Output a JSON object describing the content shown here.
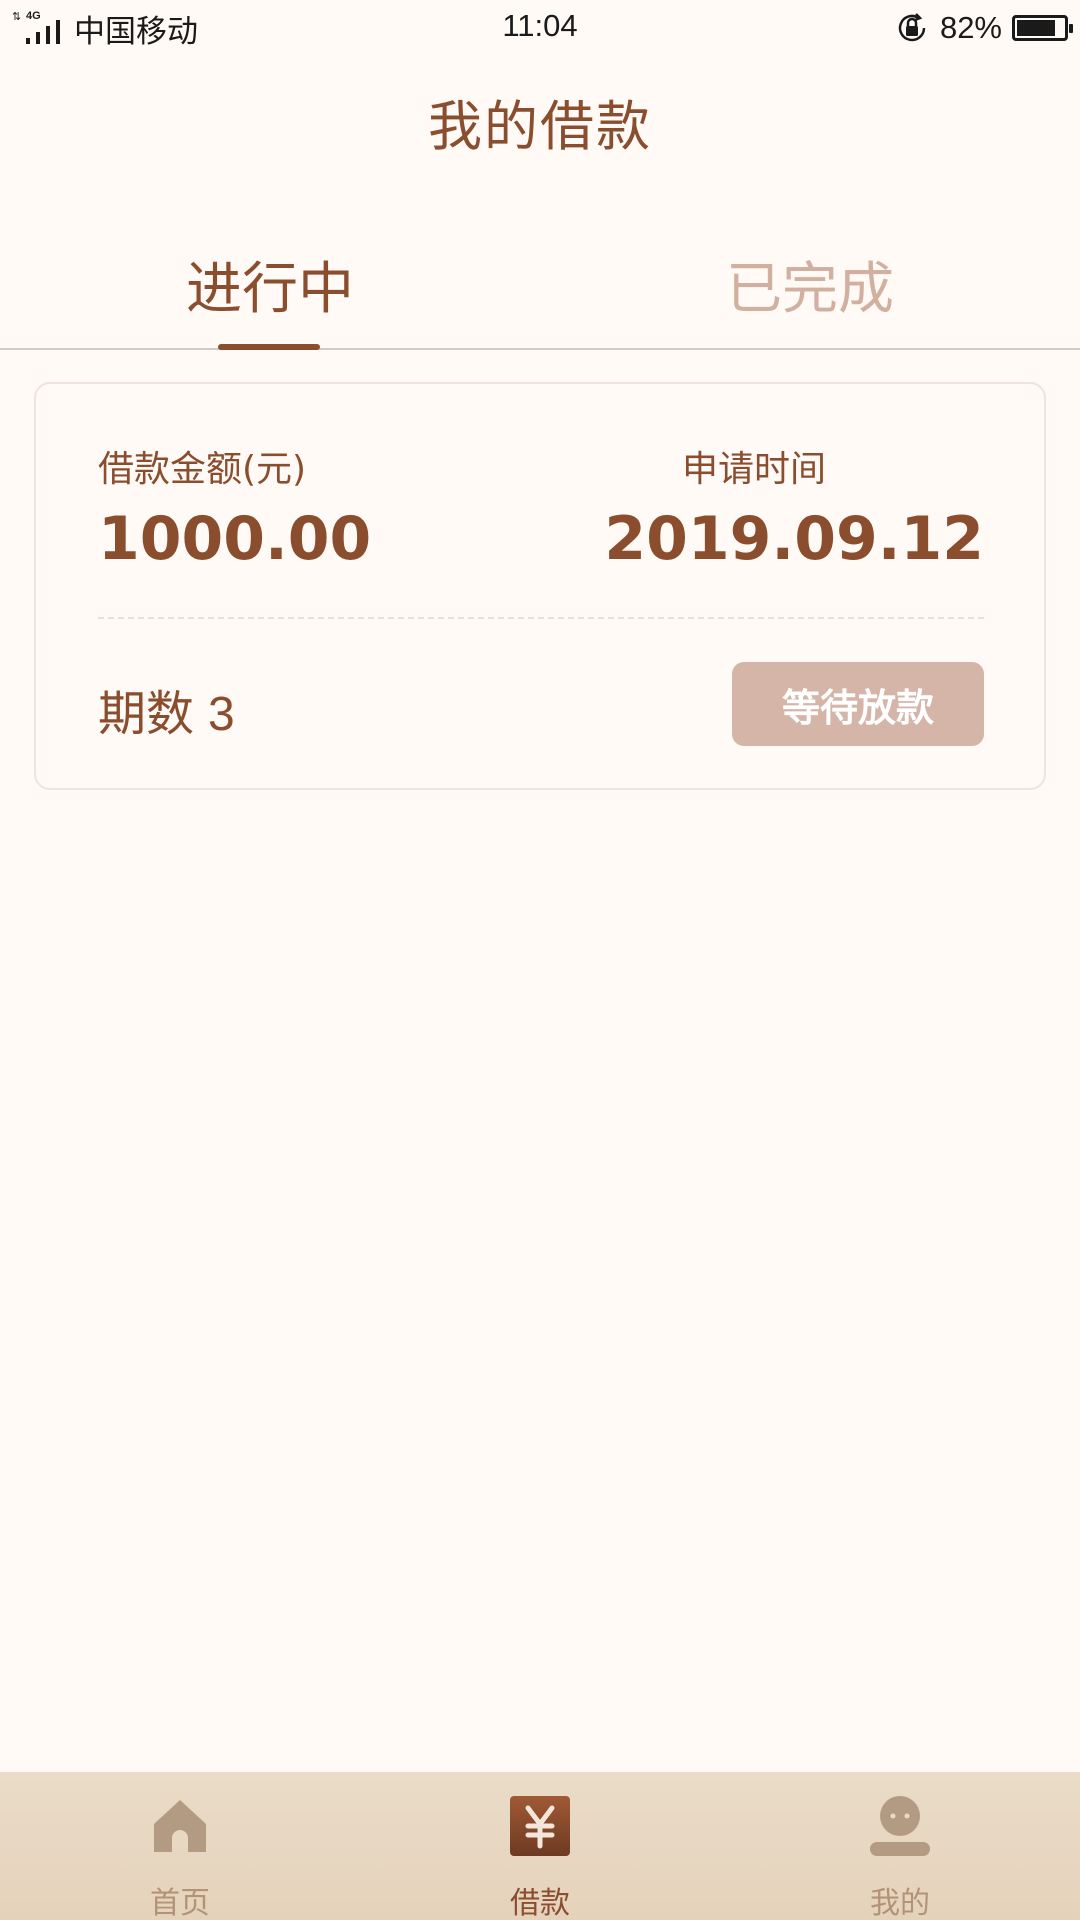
{
  "status_bar": {
    "network": "4G",
    "carrier": "中国移动",
    "time": "11:04",
    "battery_percent": "82%",
    "battery_level": 0.82
  },
  "header": {
    "title": "我的借款"
  },
  "tabs": [
    {
      "label": "进行中",
      "active": true
    },
    {
      "label": "已完成",
      "active": false
    }
  ],
  "loan_card": {
    "amount_label": "借款金额(元)",
    "amount_value": "1000.00",
    "time_label": "申请时间",
    "time_value": "2019.09.12",
    "period_label": "期数",
    "period_value": "3",
    "status_button": "等待放款"
  },
  "bottom_nav": [
    {
      "label": "首页",
      "icon": "home-icon",
      "active": false
    },
    {
      "label": "借款",
      "icon": "yen-icon",
      "active": true
    },
    {
      "label": "我的",
      "icon": "person-icon",
      "active": false
    }
  ],
  "colors": {
    "primary": "#8a4e2f",
    "inactive_tab": "#d2b0a0",
    "button_disabled": "#d4b5a8",
    "nav_inactive": "#b39378",
    "background": "#fffaf6"
  }
}
